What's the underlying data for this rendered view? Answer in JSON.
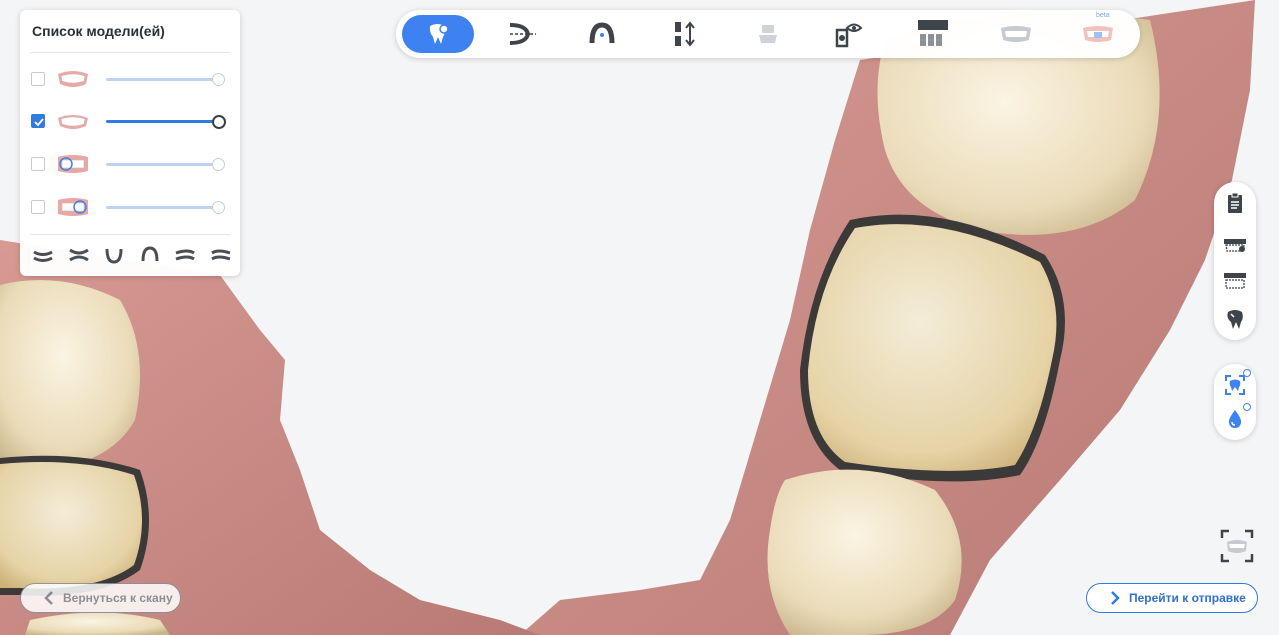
{
  "model_panel": {
    "title": "Список модели(ей)",
    "models": [
      {
        "checked": false,
        "visibility": 1.0,
        "thumbnail_icon": "upper-jaw-icon"
      },
      {
        "checked": true,
        "visibility": 1.0,
        "thumbnail_icon": "lower-jaw-icon"
      },
      {
        "checked": false,
        "visibility": 1.0,
        "thumbnail_icon": "bite-scan-icon"
      },
      {
        "checked": false,
        "visibility": 1.0,
        "thumbnail_icon": "bite-scan-2-icon"
      }
    ],
    "view_buttons": [
      "front-view-icon",
      "bite-view-icon",
      "lower-view-icon",
      "upper-view-icon",
      "left-view-icon",
      "right-view-icon"
    ]
  },
  "toolbar": {
    "tools": [
      {
        "icon": "tooth-select-icon",
        "active": true
      },
      {
        "icon": "trim-icon",
        "active": false
      },
      {
        "icon": "arch-icon",
        "active": false
      },
      {
        "icon": "bite-adjust-icon",
        "active": false
      },
      {
        "icon": "crown-icon",
        "active": false
      },
      {
        "icon": "visibility-icon",
        "active": false
      },
      {
        "icon": "section-icon",
        "active": false
      },
      {
        "icon": "denture-icon",
        "active": false
      },
      {
        "icon": "beta-tool-icon",
        "active": false,
        "badge": "beta"
      }
    ]
  },
  "right_tools": [
    "report-icon",
    "upper-teeth-icon",
    "lower-teeth-icon",
    "tooth-icon",
    "ai-scan-icon",
    "moisture-icon"
  ],
  "back_button": {
    "label": "Вернуться к скану"
  },
  "next_button": {
    "label": "Перейти к отправке"
  },
  "colors": {
    "accent": "#3d82f0",
    "gum": "#c98a84",
    "tooth": "#efe3c6"
  }
}
